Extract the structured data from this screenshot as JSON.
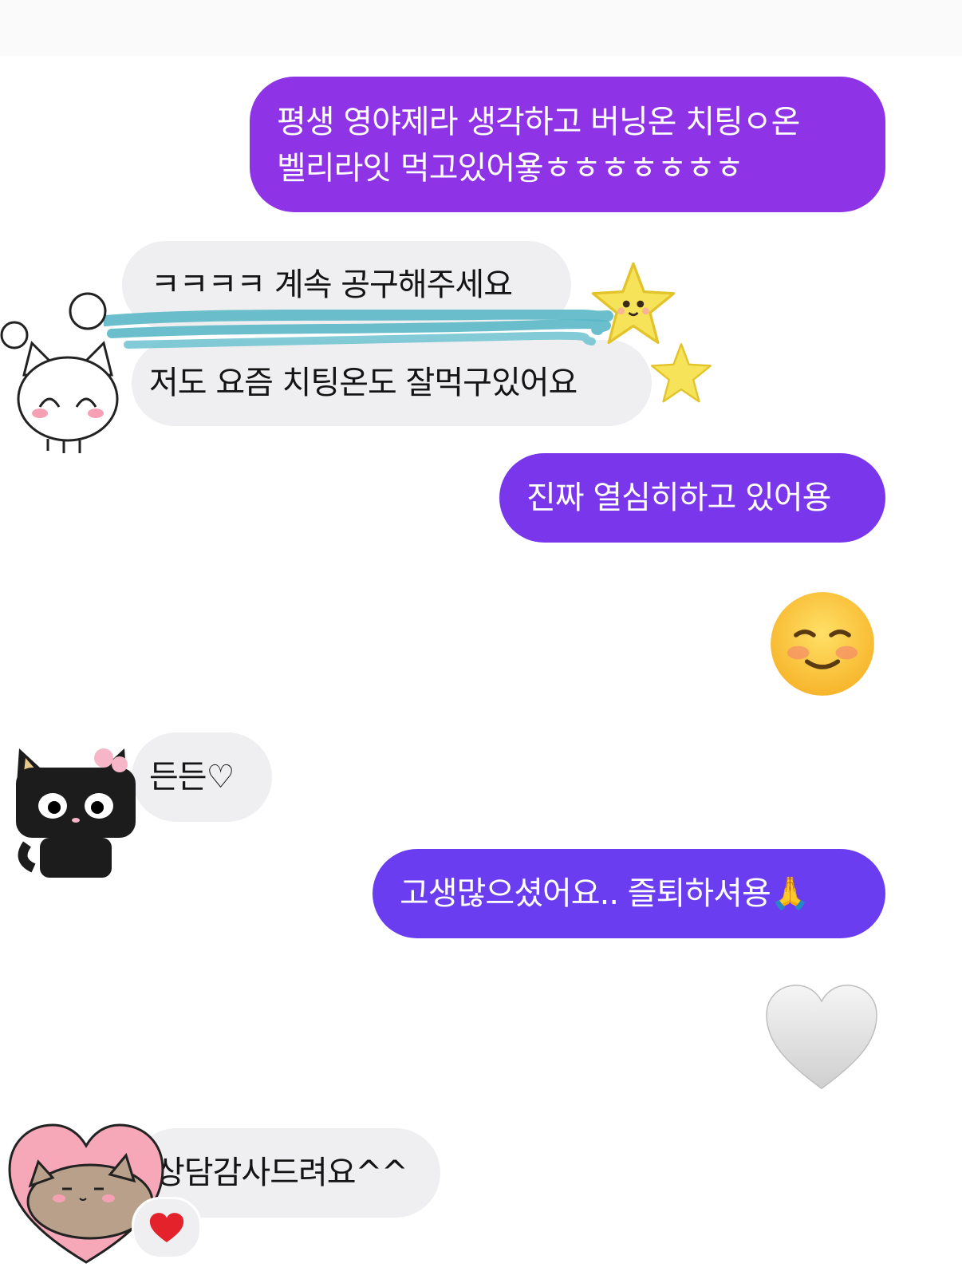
{
  "messages": [
    {
      "id": "m1",
      "side": "sent",
      "text": "평생 영야제라 생각하고 버닝온 치팅ㅇ온\n벨리라잇 먹고있어욯ㅎㅎㅎㅎㅎㅎㅎ"
    },
    {
      "id": "m2",
      "side": "received",
      "text": "ㅋㅋㅋㅋ 계속 공구해주세요"
    },
    {
      "id": "m3",
      "side": "received",
      "text": "저도  요즘 치팅온도 잘먹구있어요"
    },
    {
      "id": "m4",
      "side": "sent",
      "text": "진짜 열심히하고 있어용"
    },
    {
      "id": "m5",
      "side": "received",
      "text": "든든♡"
    },
    {
      "id": "m6",
      "side": "sent",
      "text": "고생많으셨어요.. 즐퇴하셔용🙏"
    },
    {
      "id": "m7",
      "side": "received",
      "text": "상담감사드려요^^"
    }
  ],
  "emoji_messages": [
    {
      "name": "smiling-face-emoji",
      "side": "sent"
    },
    {
      "name": "white-heart-emoji",
      "side": "sent"
    }
  ],
  "stickers": [
    "star-sticker",
    "star-sticker",
    "white-cat-sticker",
    "black-cat-sticker",
    "pusheen-heart-sticker"
  ],
  "reaction": {
    "name": "red-heart-reaction",
    "target": "m7"
  },
  "colors": {
    "sent_1": "#8e33e6",
    "sent_2": "#7a36eb",
    "sent_3": "#6a3df0",
    "received": "#efeff1",
    "scribble": "#5bb8c8"
  }
}
